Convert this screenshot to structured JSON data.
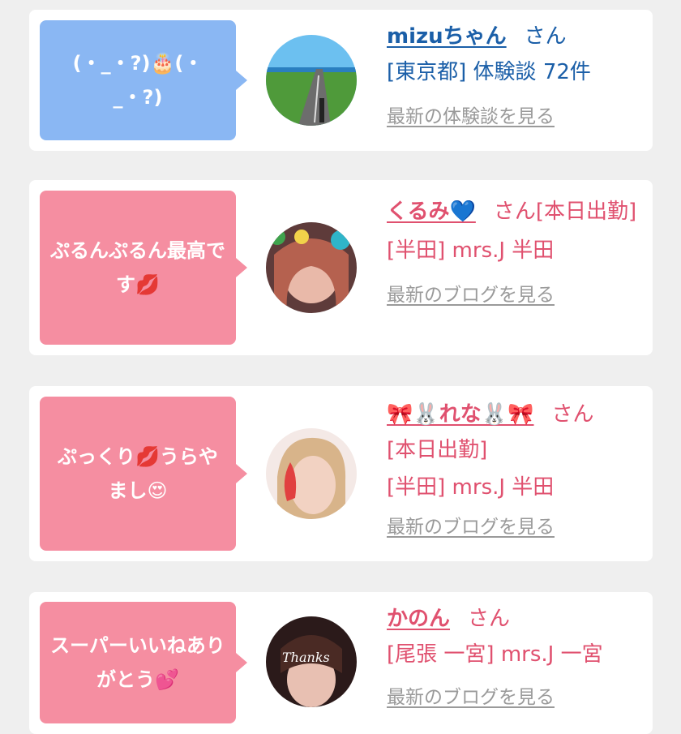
{
  "cards": [
    {
      "theme": "blue",
      "message": "(・_・?)🎂(・_・?)",
      "name": "mizuちゃん",
      "suffix": "さん",
      "line1": "[東京都] 体験談 72件",
      "line2": "",
      "link": "最新の体験談を見る",
      "avatar_desc": "road-landscape"
    },
    {
      "theme": "pink",
      "message": "ぷるんぷるん最高です💋",
      "name": "くるみ💙",
      "suffix": "さん[本日出勤]",
      "line1": "[半田] mrs.J 半田",
      "line2": "",
      "link": "最新のブログを見る",
      "avatar_desc": "woman-portrait"
    },
    {
      "theme": "pink",
      "message": "ぷっくり💋うらやまし😍",
      "name": "🎀🐰れな🐰🎀",
      "suffix": "さん",
      "line1": "[本日出勤]",
      "line2": "[半田] mrs.J 半田",
      "link": "最新のブログを見る",
      "avatar_desc": "woman-heart-sticker"
    },
    {
      "theme": "pink",
      "message": "スーパーいいねありがとう💕",
      "name": "かのん",
      "suffix": "さん",
      "line1": "[尾張 一宮] mrs.J 一宮",
      "line2": "",
      "link": "最新のブログを見る",
      "avatar_desc": "thanks-selfie"
    }
  ],
  "colors": {
    "blue_bubble": "#8ab7f3",
    "pink_bubble": "#f58ea1",
    "blue_text": "#1b5fa8",
    "pink_text": "#e0516f"
  }
}
